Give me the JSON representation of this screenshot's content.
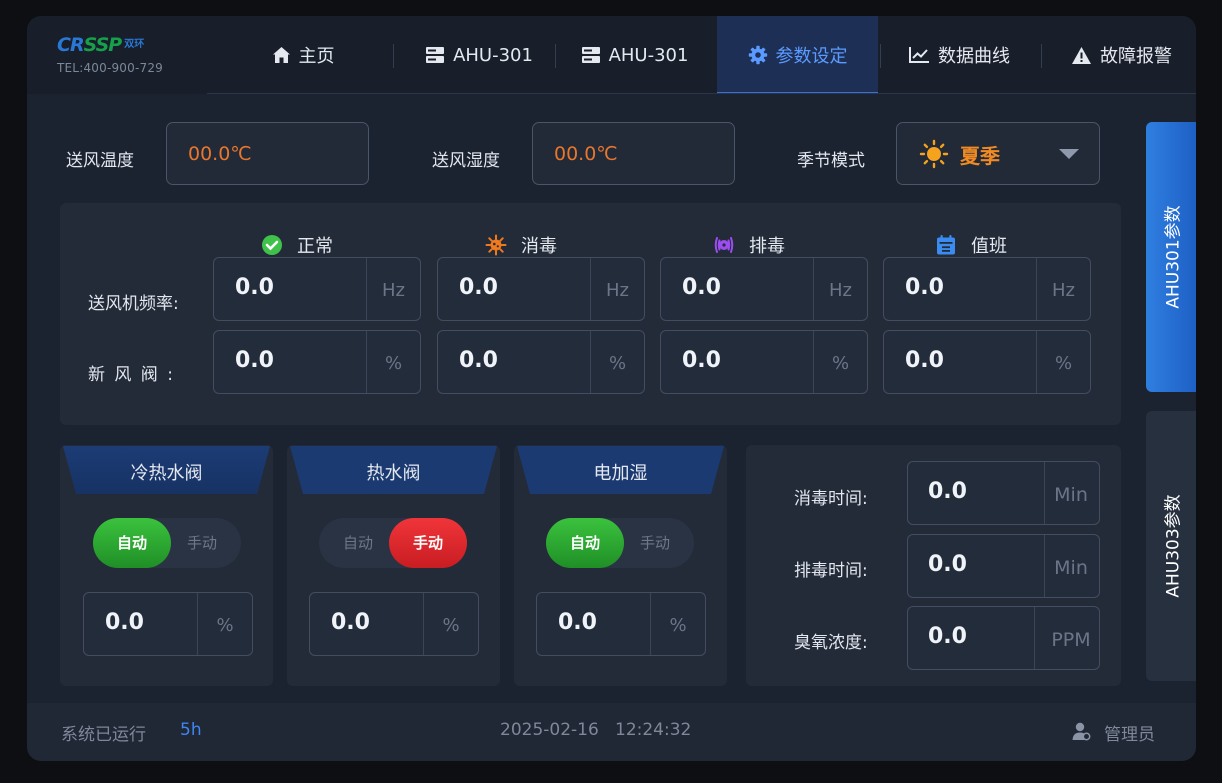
{
  "brand": {
    "logo_text": "CRSSP",
    "logo_cn": "双环",
    "tel": "TEL:400-900-729"
  },
  "nav": {
    "tabs": [
      {
        "label": "主页",
        "icon": "home-icon"
      },
      {
        "label": "AHU-301",
        "icon": "server-icon"
      },
      {
        "label": "AHU-301",
        "icon": "server-icon"
      },
      {
        "label": "参数设定",
        "icon": "gear-icon",
        "active": true
      },
      {
        "label": "数据曲线",
        "icon": "chart-line-icon"
      },
      {
        "label": "故障报警",
        "icon": "warning-icon"
      }
    ]
  },
  "top": {
    "supply_temp_label": "送风温度",
    "supply_temp_value": "00.0℃",
    "supply_humidity_label": "送风湿度",
    "supply_humidity_value": "00.0℃",
    "season_label": "季节模式",
    "season_value": "夏季",
    "season_icon": "sun-icon"
  },
  "modes": {
    "headers": [
      {
        "label": "正常",
        "icon": "check-circle-icon",
        "color": "#3ec24a"
      },
      {
        "label": "消毒",
        "icon": "virus-icon",
        "color": "#f07a1c"
      },
      {
        "label": "排毒",
        "icon": "exhaust-icon",
        "color": "#9b4df0"
      },
      {
        "label": "值班",
        "icon": "calendar-icon",
        "color": "#3a8cf0"
      }
    ],
    "rows": [
      {
        "label": "送风机频率:",
        "unit": "Hz",
        "values": [
          "0.0",
          "0.0",
          "0.0",
          "0.0"
        ]
      },
      {
        "label": "新 风 阀 :",
        "unit": "%",
        "values": [
          "0.0",
          "0.0",
          "0.0",
          "0.0"
        ]
      }
    ]
  },
  "valves": [
    {
      "title": "冷热水阀",
      "auto_label": "自动",
      "manual_label": "手动",
      "mode": "auto",
      "value": "0.0",
      "unit": "%"
    },
    {
      "title": "热水阀",
      "auto_label": "自动",
      "manual_label": "手动",
      "mode": "manual",
      "value": "0.0",
      "unit": "%"
    },
    {
      "title": "电加湿",
      "auto_label": "自动",
      "manual_label": "手动",
      "mode": "auto",
      "value": "0.0",
      "unit": "%"
    }
  ],
  "timers": [
    {
      "label": "消毒时间:",
      "value": "0.0",
      "unit": "Min"
    },
    {
      "label": "排毒时间:",
      "value": "0.0",
      "unit": "Min"
    },
    {
      "label": "臭氧浓度:",
      "value": "0.0",
      "unit": "PPM"
    }
  ],
  "side_tabs": [
    {
      "label": "AHU301参数",
      "active": true
    },
    {
      "label": "AHU303参数",
      "active": false
    }
  ],
  "footer": {
    "uptime_label": "系统已运行",
    "uptime_value": "5h",
    "datetime": "2025-02-16   12:24:32",
    "user": "管理员",
    "user_icon": "user-icon"
  },
  "colors": {
    "accent": "#3a6fd8",
    "value_orange": "#e8762c",
    "auto_green": "#2bb233",
    "manual_red": "#e0282d"
  }
}
